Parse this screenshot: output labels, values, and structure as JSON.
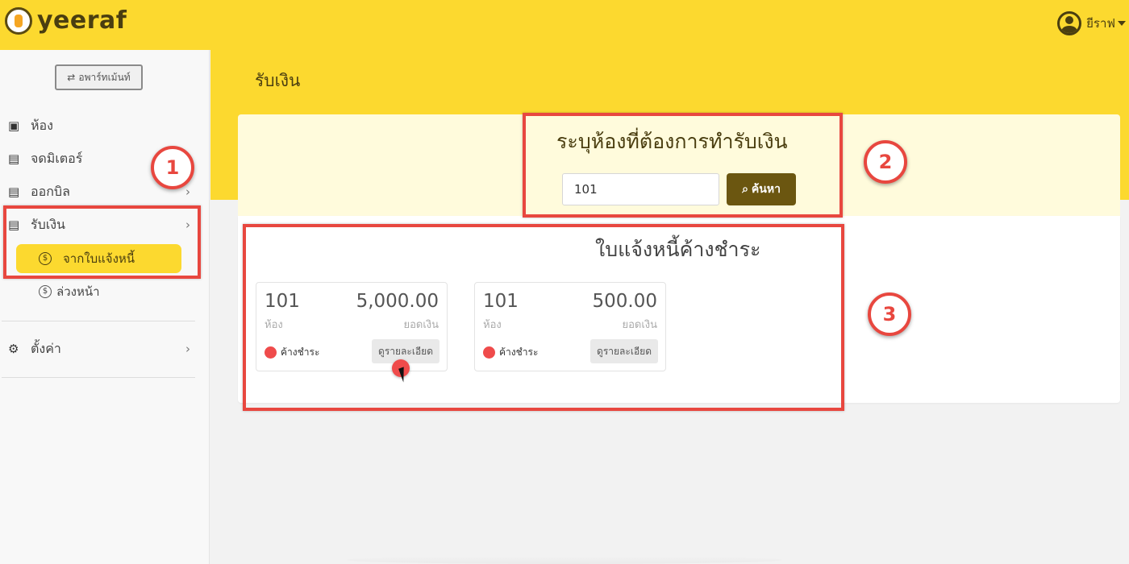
{
  "header": {
    "brand": "yeeraf",
    "user_name": "ยีราฟ"
  },
  "sidebar": {
    "apartment_button": "อพาร์ทเม้นท์",
    "items": [
      {
        "label": "ห้อง",
        "icon": "contact-card-icon"
      },
      {
        "label": "จดมิเตอร์",
        "icon": "document-edit-icon"
      },
      {
        "label": "ออกบิล",
        "icon": "document-icon"
      },
      {
        "label": "รับเงิน",
        "icon": "document-icon"
      },
      {
        "label": "ตั้งค่า",
        "icon": "gear-icon"
      }
    ],
    "sub_items": [
      {
        "label": "จากใบแจ้งหนี้",
        "icon": "dollar-circle-icon",
        "active": true
      },
      {
        "label": "ล่วงหน้า",
        "icon": "dollar-circle-icon",
        "active": false
      }
    ]
  },
  "page": {
    "title": "รับเงิน",
    "search_heading": "ระบุห้องที่ต้องการทำรับเงิน",
    "search_value": "101",
    "search_button": "ค้นหา",
    "results_heading": "ใบแจ้งหนี้ค้างชำระ"
  },
  "invoices": [
    {
      "room": "101",
      "room_label": "ห้อง",
      "amount": "5,000.00",
      "amount_label": "ยอดเงิน",
      "status": "ค้างชำระ",
      "detail_button": "ดูรายละเอียด"
    },
    {
      "room": "101",
      "room_label": "ห้อง",
      "amount": "500.00",
      "amount_label": "ยอดเงิน",
      "status": "ค้างชำระ",
      "detail_button": "ดูรายละเอียด"
    }
  ],
  "annotations": [
    "1",
    "2",
    "3"
  ],
  "colors": {
    "brand_yellow": "#fcd92f",
    "brand_dark": "#4a3e10",
    "search_button": "#6b5610",
    "status_overdue": "#ef4b4b",
    "annotation_red": "#e8473f"
  }
}
